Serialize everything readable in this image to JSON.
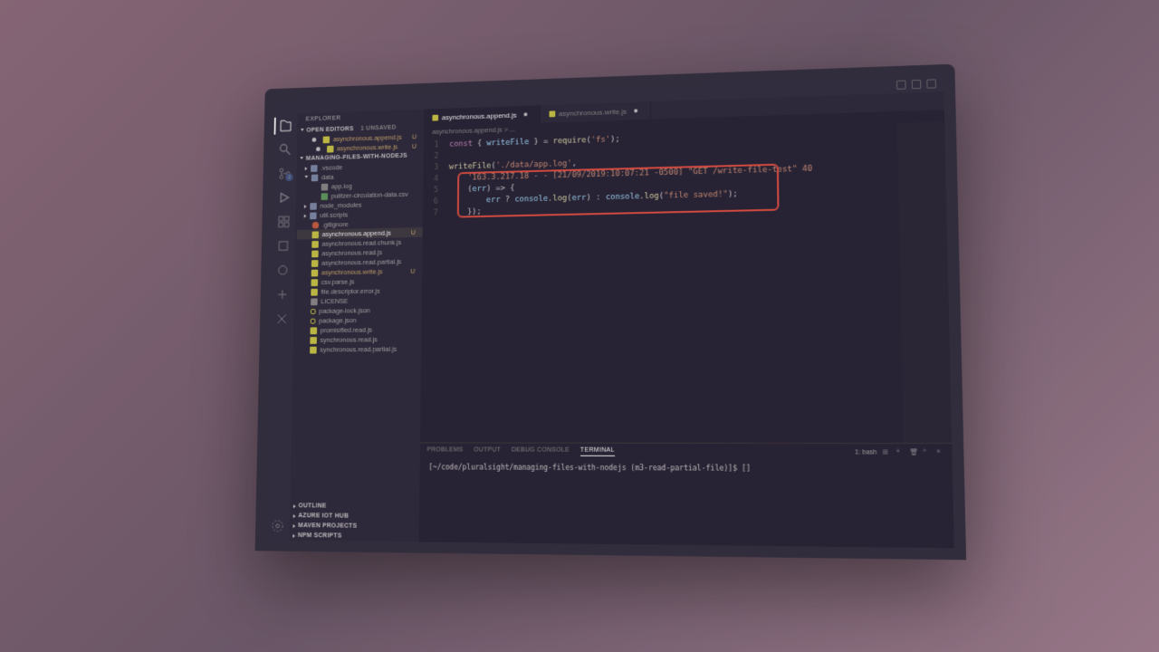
{
  "sidebar": {
    "title": "EXPLORER",
    "openEditors": {
      "label": "OPEN EDITORS",
      "unsaved": "1 UNSAVED",
      "items": [
        {
          "name": "asynchronous.append.js",
          "modified": true
        },
        {
          "name": "asynchronous.write.js",
          "modified": true
        }
      ]
    },
    "workspace": {
      "label": "MANAGING-FILES-WITH-NODEJS"
    },
    "tree": [
      {
        "name": ".vscode",
        "type": "folder"
      },
      {
        "name": "data",
        "type": "folder",
        "expanded": true
      },
      {
        "name": "app.log",
        "type": "txt",
        "nested": true
      },
      {
        "name": "pulitzer-circulation-data.csv",
        "type": "csv",
        "nested": true
      },
      {
        "name": "node_modules",
        "type": "folder"
      },
      {
        "name": "util.scripts",
        "type": "folder"
      },
      {
        "name": ".gitignore",
        "type": "git"
      },
      {
        "name": "asynchronous.append.js",
        "type": "js",
        "modified": true,
        "selected": true
      },
      {
        "name": "asynchronous.read.chunk.js",
        "type": "js"
      },
      {
        "name": "asynchronous.read.js",
        "type": "js"
      },
      {
        "name": "asynchronous.read.partial.js",
        "type": "js"
      },
      {
        "name": "asynchronous.write.js",
        "type": "js",
        "modified": true
      },
      {
        "name": "csv.parse.js",
        "type": "js"
      },
      {
        "name": "file.descriptor.error.js",
        "type": "js"
      },
      {
        "name": "LICENSE",
        "type": "txt"
      },
      {
        "name": "package-lock.json",
        "type": "json"
      },
      {
        "name": "package.json",
        "type": "json"
      },
      {
        "name": "promisified.read.js",
        "type": "js"
      },
      {
        "name": "synchronous.read.js",
        "type": "js"
      },
      {
        "name": "synchronous.read.partial.js",
        "type": "js"
      }
    ],
    "bottomSections": [
      "OUTLINE",
      "AZURE IOT HUB",
      "MAVEN PROJECTS",
      "NPM SCRIPTS"
    ]
  },
  "tabs": [
    {
      "name": "asynchronous.append.js",
      "active": true,
      "dirty": true
    },
    {
      "name": "asynchronous.write.js",
      "active": false,
      "dirty": true
    }
  ],
  "breadcrumb": "asynchronous.append.js > ...",
  "code": {
    "lines": [
      {
        "n": "1",
        "html": "<span class='kw'>const</span> <span class='op'>{</span> <span class='var'>writeFile</span> <span class='op'>} =</span> <span class='fn'>require</span><span class='op'>(</span><span class='str'>'fs'</span><span class='op'>);</span>"
      },
      {
        "n": "2",
        "html": ""
      },
      {
        "n": "3",
        "html": "<span class='fn'>writeFile</span><span class='op'>(</span><span class='str'>'./data/app.log'</span><span class='op'>,</span>"
      },
      {
        "n": "4",
        "html": "    <span class='str'>'163.3.217.18 - - [21/09/2019:10:07:21 -0500] \"GET /write-file-test\" 40</span>"
      },
      {
        "n": "5",
        "html": "    <span class='op'>(</span><span class='var'>err</span><span class='op'>) =&gt; {</span>"
      },
      {
        "n": "6",
        "html": "        <span class='var'>err</span> <span class='op'>?</span> <span class='var'>console</span><span class='op'>.</span><span class='fn'>log</span><span class='op'>(</span><span class='var'>err</span><span class='op'>) :</span> <span class='var'>console</span><span class='op'>.</span><span class='fn'>log</span><span class='op'>(</span><span class='str'>\"file saved!\"</span><span class='op'>);</span>"
      },
      {
        "n": "7",
        "html": "    <span class='op'>});</span>"
      }
    ]
  },
  "panel": {
    "tabs": [
      "PROBLEMS",
      "OUTPUT",
      "DEBUG CONSOLE",
      "TERMINAL"
    ],
    "activeTab": "TERMINAL",
    "shell": "1: bash",
    "terminalLine": "[~/code/pluralsight/managing-files-with-nodejs (m3-read-partial-file)]$ []"
  },
  "scm": {
    "badge": "2"
  }
}
